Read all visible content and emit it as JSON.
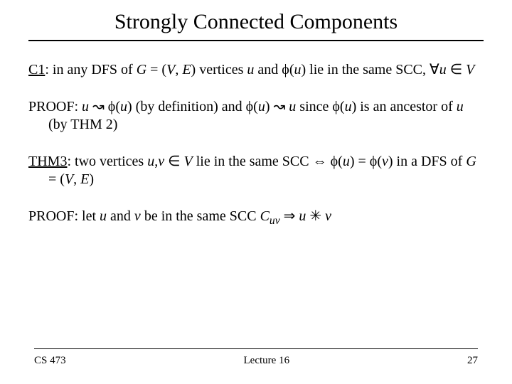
{
  "title": "Strongly Connected Components",
  "c1_label": "C1",
  "c1_a": ": in any DFS of ",
  "c1_b": " (",
  "c1_c": ") vertices ",
  "c1_d": " and ",
  "c1_e": ") lie in the same SCC, ",
  "var_G": "G",
  "eq": " = ",
  "var_V": "V",
  "comma_sp": ", ",
  "var_E": "E",
  "var_u": "u",
  "var_v": "v",
  "phi": "ϕ",
  "lp": "(",
  "rp": ")",
  "forall": "∀",
  "in": " ∈ ",
  "p1_label": "PROOF: ",
  "p1_a": " (by definition) and ",
  "p1_b": " since ",
  "p1_c": ") is an ancestor of ",
  "p1_d": " (by THM 2)",
  "leadsto": " ↝ ",
  "thm3_label": "THM3",
  "thm3_a": ": two vertices ",
  "thm3_b": " lie in the same SCC ",
  "iff": " ⇔ ",
  "thm3_c": " in a DFS of ",
  "eq2": " =  ",
  "p2_a": "PROOF: let ",
  "p2_b": " and ",
  "p2_c": " be in the same SCC ",
  "C": "C",
  "sub_uv": "uv",
  "imp": " ⇒ ",
  "star": " ✳ ",
  "comma": ",",
  "footer": {
    "left": "CS 473",
    "center": "Lecture 16",
    "right": "27"
  }
}
